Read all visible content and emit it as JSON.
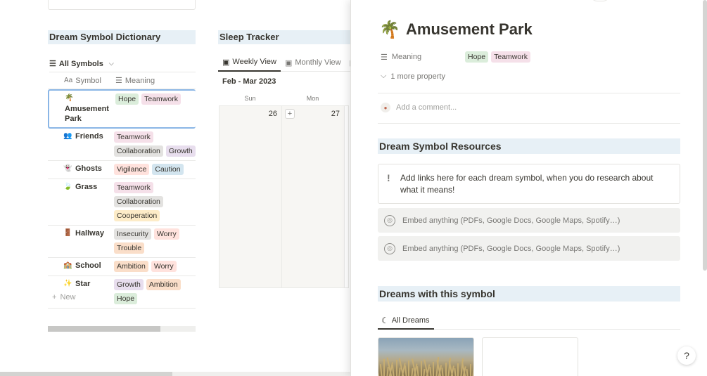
{
  "dictionary": {
    "title": "Dream Symbol Dictionary",
    "view_label": "All Symbols",
    "col_symbol": "Symbol",
    "col_meaning": "Meaning",
    "rows": [
      {
        "name": "Amusement Park",
        "icon": "palm-tree-icon",
        "glyph": "🌴",
        "tags": [
          {
            "label": "Hope",
            "color": "green"
          },
          {
            "label": "Teamwork",
            "color": "pink"
          }
        ]
      },
      {
        "name": "Friends",
        "icon": "people-icon",
        "glyph": "👥",
        "tags": [
          {
            "label": "Teamwork",
            "color": "pink"
          },
          {
            "label": "Collaboration",
            "color": "gray"
          },
          {
            "label": "Growth",
            "color": "purple"
          }
        ]
      },
      {
        "name": "Ghosts",
        "icon": "ghost-icon",
        "glyph": "👻",
        "tags": [
          {
            "label": "Vigilance",
            "color": "red"
          },
          {
            "label": "Caution",
            "color": "blue"
          }
        ]
      },
      {
        "name": "Grass",
        "icon": "leaf-icon",
        "glyph": "🍃",
        "tags": [
          {
            "label": "Teamwork",
            "color": "pink"
          },
          {
            "label": "Collaboration",
            "color": "gray"
          },
          {
            "label": "Cooperation",
            "color": "yellow"
          }
        ]
      },
      {
        "name": "Hallway",
        "icon": "door-icon",
        "glyph": "🚪",
        "tags": [
          {
            "label": "Insecurity",
            "color": "gray"
          },
          {
            "label": "Worry",
            "color": "red"
          },
          {
            "label": "Trouble",
            "color": "orange"
          }
        ]
      },
      {
        "name": "School",
        "icon": "school-icon",
        "glyph": "🏫",
        "tags": [
          {
            "label": "Ambition",
            "color": "orange"
          },
          {
            "label": "Worry",
            "color": "red"
          }
        ]
      },
      {
        "name": "Star",
        "icon": "sparkle-icon",
        "glyph": "✨",
        "tags": [
          {
            "label": "Growth",
            "color": "purple"
          },
          {
            "label": "Ambition",
            "color": "orange"
          },
          {
            "label": "Hope",
            "color": "green"
          }
        ]
      }
    ],
    "new_label": "New"
  },
  "sleep": {
    "title": "Sleep Tracker",
    "tabs": [
      "Weekly View",
      "Monthly View"
    ],
    "range": "Feb - Mar 2023",
    "days": [
      "Sun",
      "Mon"
    ],
    "dates": [
      "26",
      "27"
    ]
  },
  "peek": {
    "title": "Amusement Park",
    "icon": "palm-tree-icon",
    "meaning_label": "Meaning",
    "meaning_tags": [
      {
        "label": "Hope",
        "color": "green"
      },
      {
        "label": "Teamwork",
        "color": "pink"
      }
    ],
    "more_property": "1 more property",
    "comment_placeholder": "Add a comment...",
    "resources_title": "Dream Symbol Resources",
    "callout_text": "Add links here for each dream symbol, when you do research about what it means!",
    "embed_1": "Embed anything (PDFs, Google Docs, Google Maps, Spotify…)",
    "embed_2": "Embed anything (PDFs, Google Docs, Google Maps, Spotify…)",
    "dreams_title": "Dreams with this symbol",
    "dreams_tab": "All Dreams"
  },
  "help_label": "?",
  "colors": {
    "section_bg": "#e7f0f6",
    "tag_green": "#dbeddb",
    "tag_pink": "#f5e0e9",
    "tag_gray": "#e3e2e0",
    "tag_purple": "#e8deee",
    "tag_blue": "#d3e5ef",
    "tag_red": "#ffe2dd",
    "tag_orange": "#fadec9",
    "tag_yellow": "#fdecc8"
  }
}
